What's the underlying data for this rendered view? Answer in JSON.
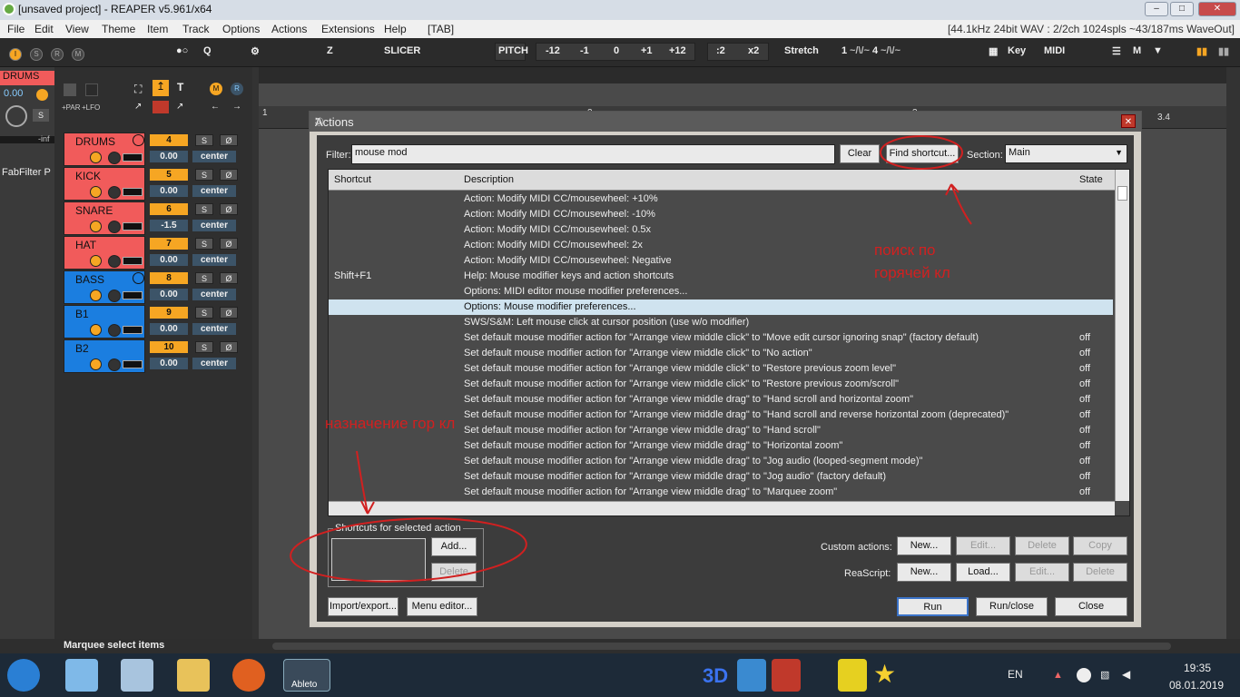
{
  "window": {
    "title": "[unsaved project] - REAPER v5.961/x64"
  },
  "menu": {
    "items": [
      "File",
      "Edit",
      "View",
      "Theme",
      "Item",
      "Track",
      "Options",
      "Actions",
      "Extensions",
      "Help",
      "[TAB]"
    ],
    "status": "[44.1kHz 24bit WAV : 2/2ch 1024spls ~43/187ms WaveOut]"
  },
  "toolbar": {
    "q": "Q",
    "z": "Z",
    "slicer": "SLICER",
    "pitch": "PITCH",
    "pitch_values": [
      "-12",
      "-1",
      "0",
      "+1",
      "+12"
    ],
    "stretch_values": [
      ":2",
      "x2"
    ],
    "stretch": "Stretch",
    "key": "Key",
    "midi": "MIDI",
    "m": "M",
    "left_buttons": [
      "I",
      "S",
      "R",
      "M"
    ],
    "ts_a": "1",
    "ts_b": "4",
    "par": "+PAR",
    "lfo": "+LFO",
    "mcp_m": "M",
    "mcp_r": "R"
  },
  "mcp": {
    "track": "DRUMS",
    "value": "0.00",
    "s": "S",
    "inf": "-inf",
    "fx": "FabFilter P"
  },
  "tracks": [
    {
      "name": "DRUMS",
      "num": "4",
      "vol": "0.00",
      "pan": "center",
      "color": "#f15b5b"
    },
    {
      "name": "KICK",
      "num": "5",
      "vol": "0.00",
      "pan": "center",
      "color": "#f15b5b"
    },
    {
      "name": "SNARE",
      "num": "6",
      "vol": "-1.5",
      "pan": "center",
      "color": "#f15b5b"
    },
    {
      "name": "HAT",
      "num": "7",
      "vol": "0.00",
      "pan": "center",
      "color": "#f15b5b"
    },
    {
      "name": "BASS",
      "num": "8",
      "vol": "0.00",
      "pan": "center",
      "color": "#1b7ee0"
    },
    {
      "name": "B1",
      "num": "9",
      "vol": "0.00",
      "pan": "center",
      "color": "#1b7ee0"
    },
    {
      "name": "B2",
      "num": "10",
      "vol": "0.00",
      "pan": "center",
      "color": "#1b7ee0"
    }
  ],
  "track_s": "S",
  "ruler": {
    "start": "1",
    "end": "3.4",
    "mid": "2",
    "mid2": "3"
  },
  "status": {
    "marquee": "Marquee select items"
  },
  "dialog": {
    "title": "Actions",
    "filter_label": "Filter:",
    "filter_value": "mouse mod",
    "clear": "Clear",
    "find": "Find shortcut...",
    "section_label": "Section:",
    "section_value": "Main",
    "col_shortcut": "Shortcut",
    "col_desc": "Description",
    "col_state": "State",
    "rows": [
      {
        "sc": "",
        "ds": "Action: Modify MIDI CC/mousewheel: +10%",
        "st": ""
      },
      {
        "sc": "",
        "ds": "Action: Modify MIDI CC/mousewheel: -10%",
        "st": ""
      },
      {
        "sc": "",
        "ds": "Action: Modify MIDI CC/mousewheel: 0.5x",
        "st": ""
      },
      {
        "sc": "",
        "ds": "Action: Modify MIDI CC/mousewheel: 2x",
        "st": ""
      },
      {
        "sc": "",
        "ds": "Action: Modify MIDI CC/mousewheel: Negative",
        "st": ""
      },
      {
        "sc": "Shift+F1",
        "ds": "Help: Mouse modifier keys and action shortcuts",
        "st": ""
      },
      {
        "sc": "",
        "ds": "Options: MIDI editor mouse modifier preferences...",
        "st": ""
      },
      {
        "sc": "",
        "ds": "Options: Mouse modifier preferences...",
        "st": ""
      },
      {
        "sc": "",
        "ds": "SWS/S&M: Left mouse click at cursor position (use w/o modifier)",
        "st": ""
      },
      {
        "sc": "",
        "ds": "Set default mouse modifier action for \"Arrange view middle click\" to \"Move edit cursor ignoring snap\" (factory default)",
        "st": "off"
      },
      {
        "sc": "",
        "ds": "Set default mouse modifier action for \"Arrange view middle click\" to \"No action\"",
        "st": "off"
      },
      {
        "sc": "",
        "ds": "Set default mouse modifier action for \"Arrange view middle click\" to \"Restore previous zoom level\"",
        "st": "off"
      },
      {
        "sc": "",
        "ds": "Set default mouse modifier action for \"Arrange view middle click\" to \"Restore previous zoom/scroll\"",
        "st": "off"
      },
      {
        "sc": "",
        "ds": "Set default mouse modifier action for \"Arrange view middle drag\" to \"Hand scroll and horizontal zoom\"",
        "st": "off"
      },
      {
        "sc": "",
        "ds": "Set default mouse modifier action for \"Arrange view middle drag\" to \"Hand scroll and reverse horizontal zoom (deprecated)\"",
        "st": "off"
      },
      {
        "sc": "",
        "ds": "Set default mouse modifier action for \"Arrange view middle drag\" to \"Hand scroll\"",
        "st": "off"
      },
      {
        "sc": "",
        "ds": "Set default mouse modifier action for \"Arrange view middle drag\" to \"Horizontal zoom\"",
        "st": "off"
      },
      {
        "sc": "",
        "ds": "Set default mouse modifier action for \"Arrange view middle drag\" to \"Jog audio (looped-segment mode)\"",
        "st": "off"
      },
      {
        "sc": "",
        "ds": "Set default mouse modifier action for \"Arrange view middle drag\" to \"Jog audio\" (factory default)",
        "st": "off"
      },
      {
        "sc": "",
        "ds": "Set default mouse modifier action for \"Arrange view middle drag\" to \"Marquee zoom\"",
        "st": "off"
      }
    ],
    "shortcuts_group": "Shortcuts for selected action",
    "add": "Add...",
    "delete": "Delete",
    "custom_actions": "Custom actions:",
    "reascript": "ReaScript:",
    "new": "New...",
    "edit": "Edit...",
    "copy": "Copy",
    "load": "Load...",
    "import": "Import/export...",
    "menu_editor": "Menu editor...",
    "run": "Run",
    "run_close": "Run/close",
    "close": "Close"
  },
  "annotations": {
    "find_note_1": "поиск по",
    "find_note_2": "горячей кл",
    "assign_note": "назначение гор кл"
  },
  "taskbar": {
    "lang": "EN",
    "time": "19:35",
    "date": "08.01.2019",
    "tdlabel": "3D",
    "ableton": "Ableto"
  }
}
